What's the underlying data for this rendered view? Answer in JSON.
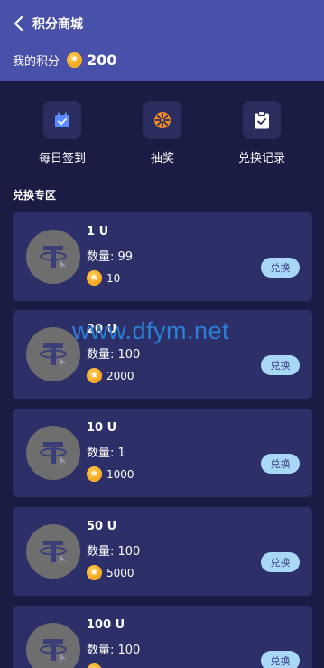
{
  "header": {
    "title": "积分商城",
    "points_label": "我的积分",
    "points_value": "200",
    "coin_icon": "star-coin-icon"
  },
  "actions": [
    {
      "label": "每日签到",
      "icon": "calendar-check-icon",
      "color": "#5b8cff"
    },
    {
      "label": "抽奖",
      "icon": "prize-wheel-icon",
      "color": "#f08a24"
    },
    {
      "label": "兑换记录",
      "icon": "clipboard-check-icon",
      "color": "#ffffff"
    }
  ],
  "section": {
    "title": "兑换专区"
  },
  "products": [
    {
      "name": "1 U",
      "qty_label": "数量: 99",
      "cost": "10",
      "button": "兑换"
    },
    {
      "name": "20 U",
      "qty_label": "数量: 100",
      "cost": "2000",
      "button": "兑换"
    },
    {
      "name": "10 U",
      "qty_label": "数量: 1",
      "cost": "1000",
      "button": "兑换"
    },
    {
      "name": "50 U",
      "qty_label": "数量: 100",
      "cost": "5000",
      "button": "兑换"
    },
    {
      "name": "100 U",
      "qty_label": "数量: 100",
      "cost": "",
      "button": "兑换"
    }
  ],
  "watermark": "www.dfym.net",
  "colors": {
    "header_bg": "#4950a9",
    "page_bg": "#1b1c44",
    "card_bg": "#2d2f68",
    "button_bg": "#a9d8f7",
    "coin": "#f3a41b"
  }
}
